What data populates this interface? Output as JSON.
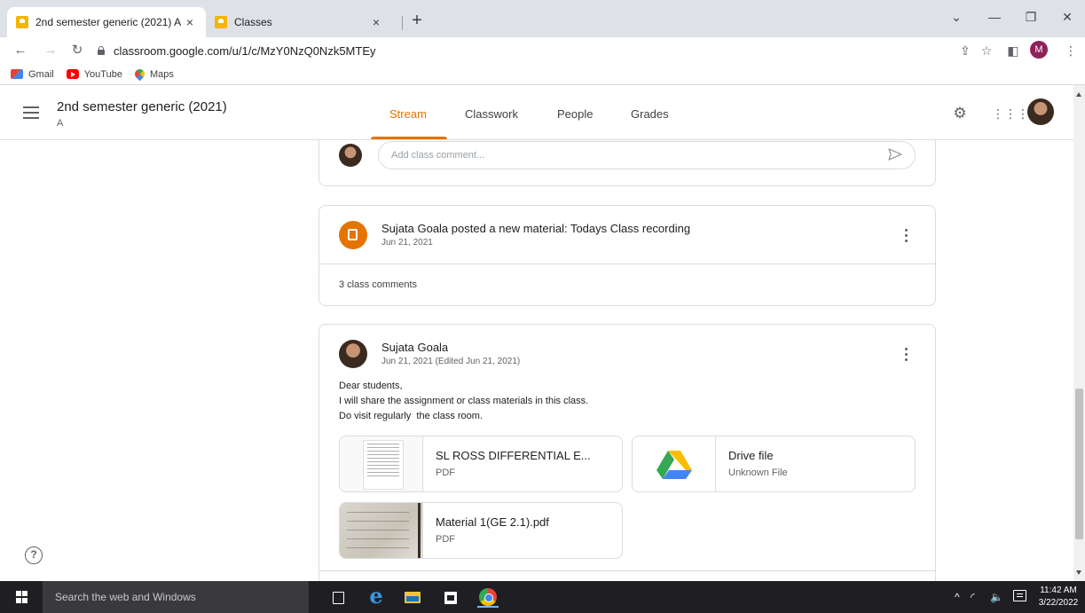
{
  "browser": {
    "tabs": [
      {
        "title": "2nd semester generic (2021) A",
        "close": "×",
        "active": true
      },
      {
        "title": "Classes",
        "close": "×",
        "active": false
      }
    ],
    "new_tab": "+",
    "url": "classroom.google.com/u/1/c/MzY0NzQ0Nzk5MTEy",
    "profile_initial": "M",
    "bookmarks": [
      "Gmail",
      "YouTube",
      "Maps"
    ]
  },
  "classroom": {
    "course_title": "2nd semester generic (2021)",
    "course_section": "A",
    "nav_tabs": [
      "Stream",
      "Classwork",
      "People",
      "Grades"
    ],
    "active_tab": "Stream",
    "accent_color": "#e37400"
  },
  "stream": {
    "comment_box": {
      "placeholder": "Add class comment..."
    },
    "material_post": {
      "title": "Sujata Goala posted a new material: Todays Class recording",
      "date": "Jun 21, 2021",
      "comments": "3 class comments"
    },
    "announcement": {
      "author": "Sujata Goala",
      "date": "Jun 21, 2021 (Edited Jun 21, 2021)",
      "body": [
        "Dear students,",
        "I will share the assignment or class materials in this class.",
        "Do visit regularly  the class room."
      ],
      "attachments": [
        {
          "name": "SL ROSS DIFFERENTIAL E...",
          "type": "PDF"
        },
        {
          "name": "Drive file",
          "type": "Unknown File"
        },
        {
          "name": "Material 1(GE 2.1).pdf",
          "type": "PDF"
        }
      ]
    }
  },
  "help": "?",
  "taskbar": {
    "search_placeholder": "Search the web and Windows",
    "time": "11:42 AM",
    "date": "3/22/2022"
  }
}
